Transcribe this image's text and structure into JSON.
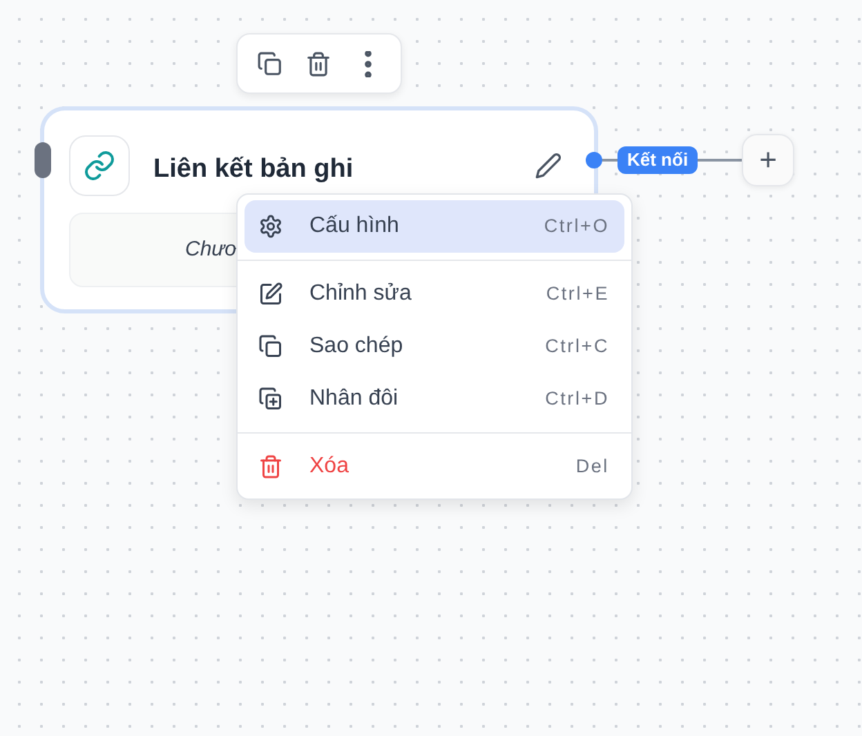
{
  "toolbar": {
    "buttons": [
      {
        "kind": "copy"
      },
      {
        "kind": "delete"
      },
      {
        "kind": "more"
      }
    ]
  },
  "node": {
    "title": "Liên kết bản ghi",
    "body_text": "Chươ",
    "connector_label": "Kết nối"
  },
  "add_button": {
    "label": "+"
  },
  "context_menu": {
    "groups": [
      [
        {
          "kind": "settings",
          "label": "Cấu hình",
          "shortcut": "Ctrl+O",
          "selected": true
        }
      ],
      [
        {
          "kind": "edit",
          "label": "Chỉnh sửa",
          "shortcut": "Ctrl+E",
          "selected": false
        },
        {
          "kind": "copy",
          "label": "Sao chép",
          "shortcut": "Ctrl+C",
          "selected": false
        },
        {
          "kind": "duplicate",
          "label": "Nhân đôi",
          "shortcut": "Ctrl+D",
          "selected": false
        }
      ],
      [
        {
          "kind": "delete",
          "label": "Xóa",
          "shortcut": "Del",
          "selected": false
        }
      ]
    ]
  }
}
